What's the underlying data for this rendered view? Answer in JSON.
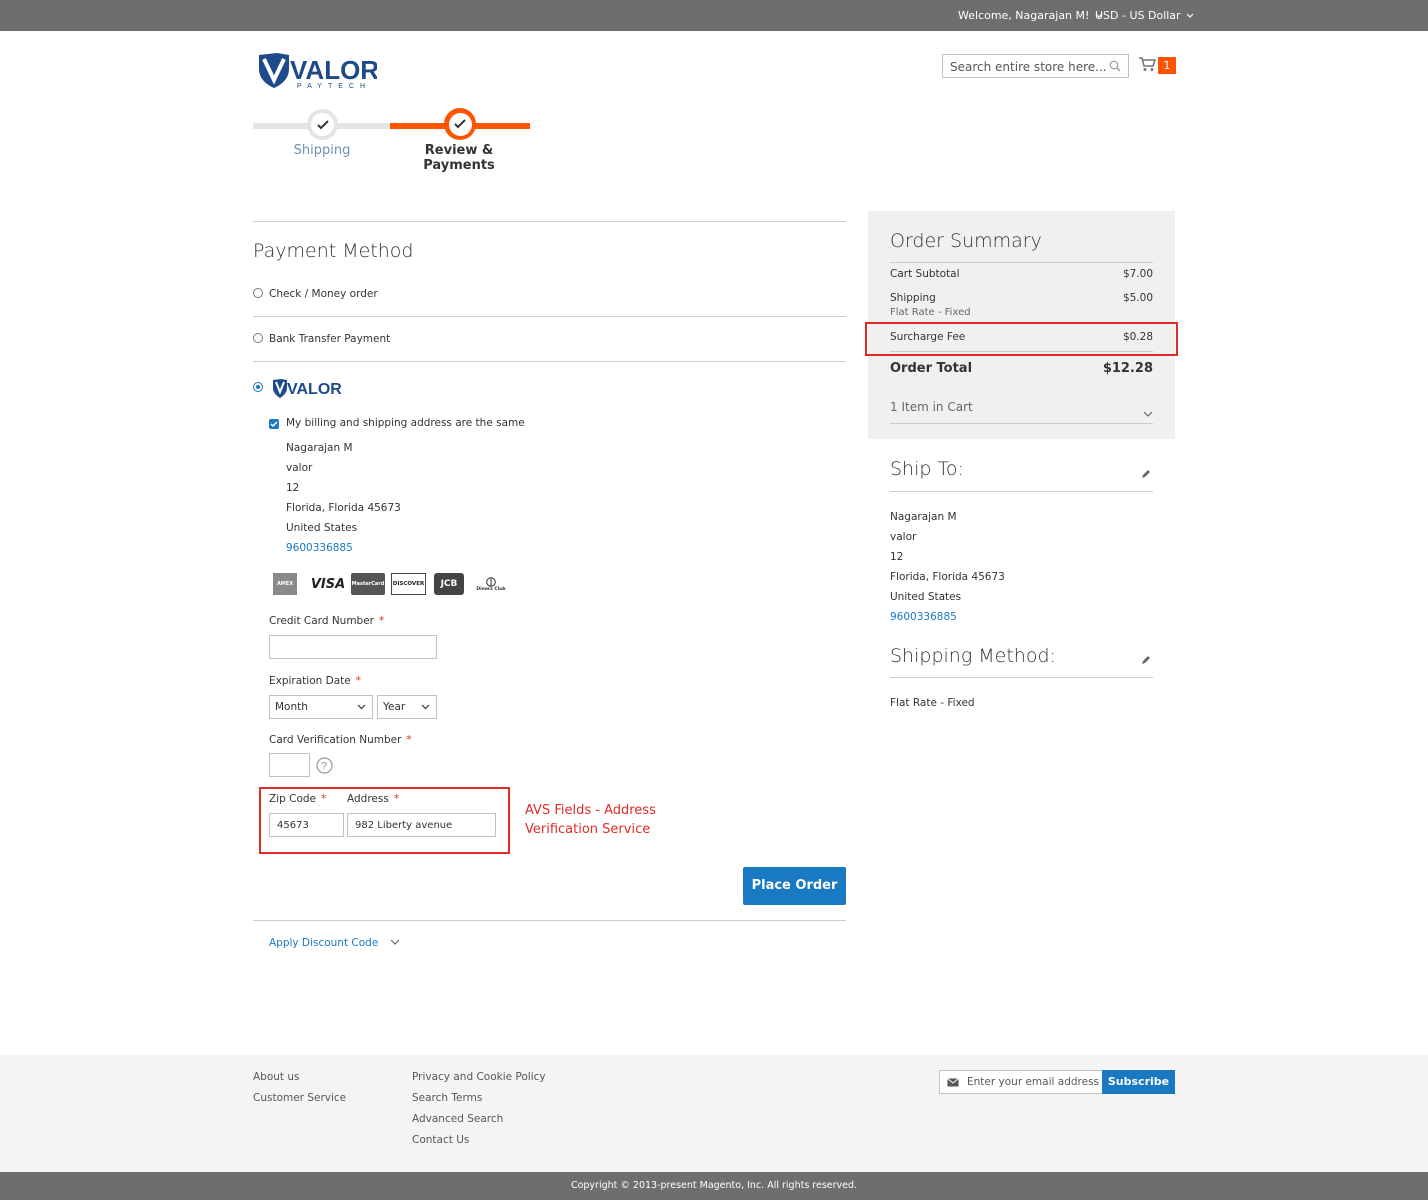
{
  "header": {
    "welcome": "Welcome, Nagarajan M!",
    "currency": "USD - US Dollar",
    "search_placeholder": "Search entire store here...",
    "cart_count": "1",
    "logo_text": "VALOR",
    "logo_sub": "PAYTECH"
  },
  "progress": {
    "steps": [
      {
        "label": "Shipping",
        "state": "complete"
      },
      {
        "label": "Review & Payments",
        "state": "active"
      }
    ]
  },
  "payment": {
    "title": "Payment Method",
    "options": [
      {
        "label": "Check / Money order",
        "selected": false
      },
      {
        "label": "Bank Transfer Payment",
        "selected": false
      },
      {
        "label": "VALOR",
        "selected": true
      }
    ],
    "same_address_label": "My billing and shipping address are the same",
    "billing_address": {
      "name": "Nagarajan M",
      "company": "valor",
      "street": "12",
      "city_line": "Florida, Florida 45673",
      "country": "United States",
      "phone": "9600336885"
    },
    "cards": [
      "AMEX",
      "VISA",
      "MasterCard",
      "DISCOVER",
      "JCB",
      "Diners Club"
    ],
    "cc_label": "Credit Card Number",
    "exp_label": "Expiration Date",
    "month": "Month",
    "year": "Year",
    "cvv_label": "Card Verification Number",
    "zip_label": "Zip Code",
    "zip_value": "45673",
    "address_label": "Address",
    "address_value": "982 Liberty avenue",
    "avs_note_line1": "AVS Fields - Address",
    "avs_note_line2": "Verification Service",
    "place_order": "Place Order",
    "discount": "Apply Discount Code"
  },
  "summary": {
    "title": "Order Summary",
    "rows": [
      {
        "label": "Cart Subtotal",
        "value": "$7.00"
      },
      {
        "label": "Shipping",
        "sub": "Flat Rate - Fixed",
        "value": "$5.00"
      },
      {
        "label": "Surcharge Fee",
        "value": "$0.28"
      }
    ],
    "total_label": "Order Total",
    "total_value": "$12.28",
    "items": "1 Item in Cart"
  },
  "ship_to": {
    "title": "Ship To:",
    "name": "Nagarajan M",
    "company": "valor",
    "street": "12",
    "city_line": "Florida, Florida 45673",
    "country": "United States",
    "phone": "9600336885"
  },
  "shipping_method": {
    "title": "Shipping Method:",
    "value": "Flat Rate - Fixed"
  },
  "footer": {
    "col1": [
      "About us",
      "Customer Service"
    ],
    "col2": [
      "Privacy and Cookie Policy",
      "Search Terms",
      "Advanced Search",
      "Contact Us"
    ],
    "email_placeholder": "Enter your email address",
    "subscribe": "Subscribe",
    "copyright": "Copyright © 2013-present Magento, Inc. All rights reserved."
  },
  "colors": {
    "accent": "#1979c3",
    "orange": "#ff5501",
    "highlight": "#e02b27",
    "topbar": "#6e6e6e"
  }
}
